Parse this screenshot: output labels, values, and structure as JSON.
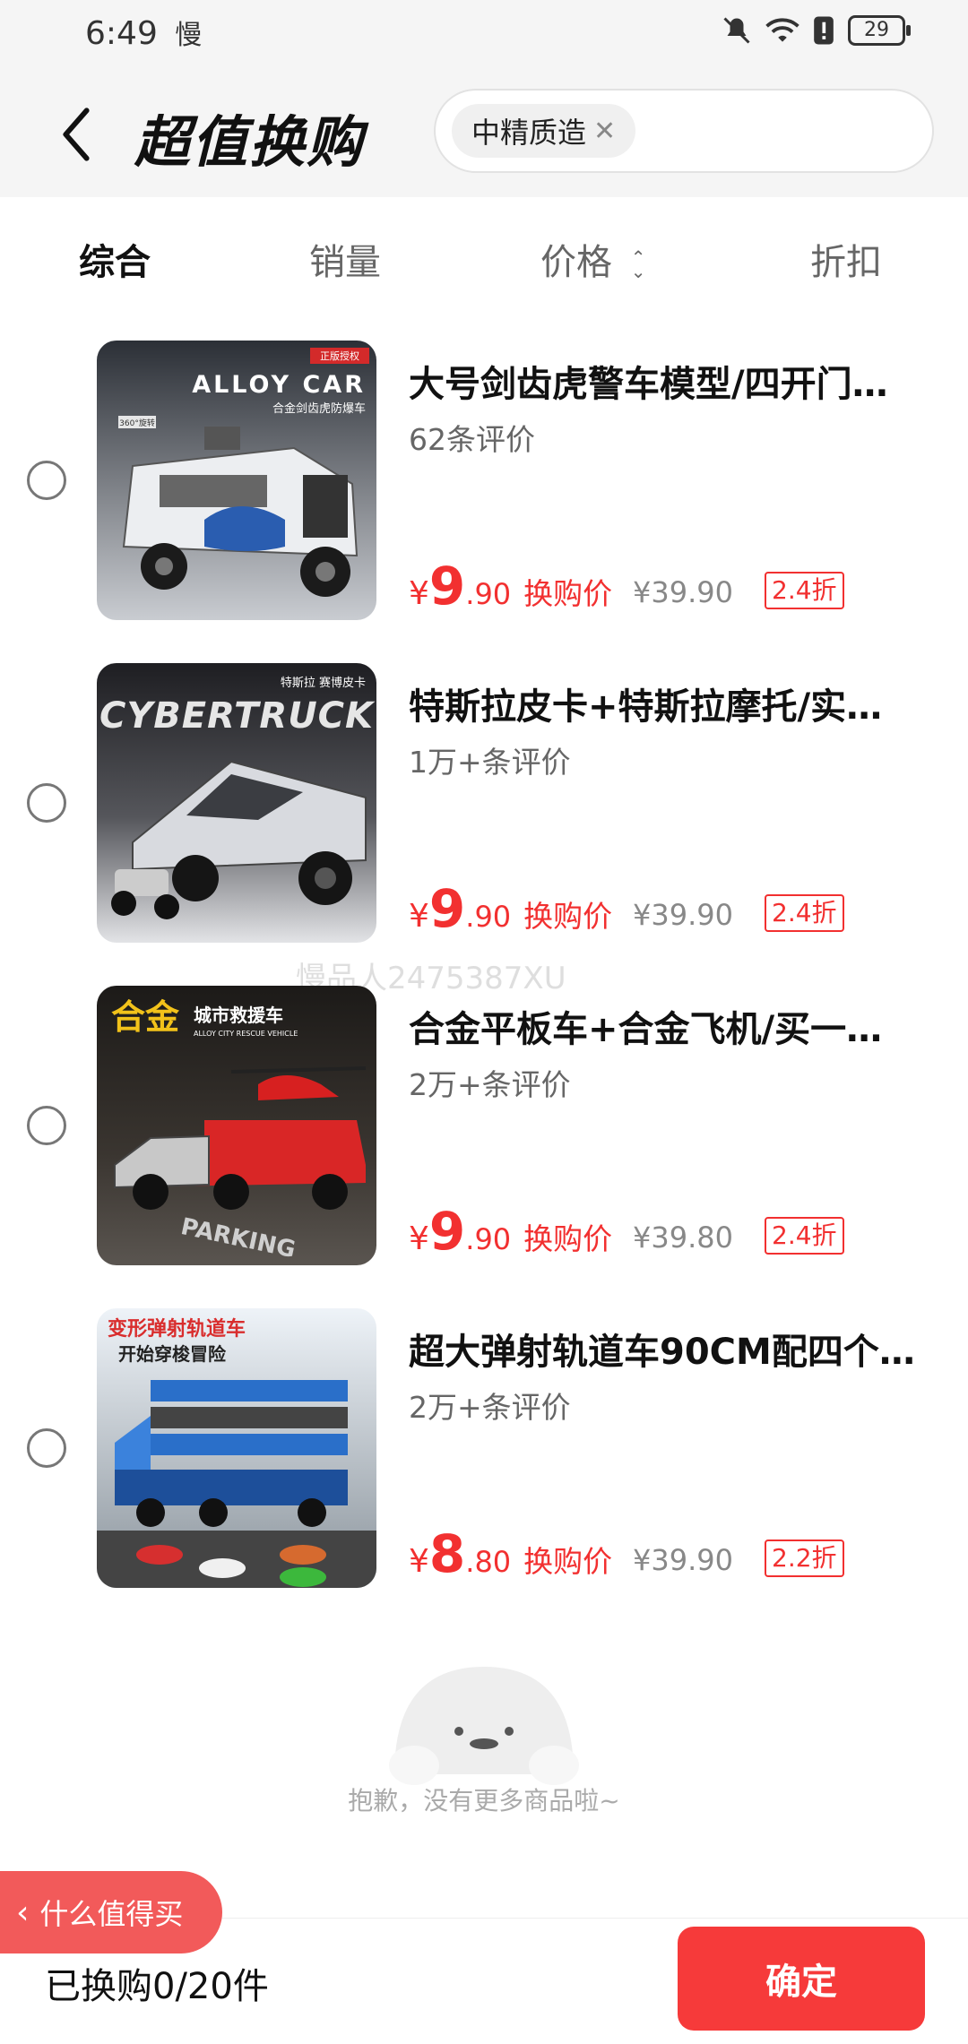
{
  "status_bar": {
    "time": "6:49",
    "app_label": "慢",
    "battery": "29"
  },
  "header": {
    "title": "超值换购",
    "search_chip": "中精质造"
  },
  "tabs": [
    {
      "label": "综合",
      "active": true
    },
    {
      "label": "销量"
    },
    {
      "label": "价格"
    },
    {
      "label": "折扣"
    }
  ],
  "products": [
    {
      "title": "大号剑齿虎警车模型/四开门…",
      "reviews": "62条评价",
      "price_symbol": "¥",
      "price_int": "9",
      "price_dec": ".90",
      "price_label": "换购价",
      "original_price": "¥39.90",
      "discount": "2.4折",
      "thumb_text": "ALLOY CAR",
      "thumb_sub": "合金剑齿虎防爆车",
      "thumb_badge": "正版授权",
      "thumb_tag": "360°旋转"
    },
    {
      "title": "特斯拉皮卡+特斯拉摩托/实…",
      "reviews": "1万+条评价",
      "price_symbol": "¥",
      "price_int": "9",
      "price_dec": ".90",
      "price_label": "换购价",
      "original_price": "¥39.90",
      "discount": "2.4折",
      "thumb_text": "CYBERTRUCK",
      "thumb_sub": "特斯拉 赛博皮卡"
    },
    {
      "title": "合金平板车+合金飞机/买一…",
      "reviews": "2万+条评价",
      "price_symbol": "¥",
      "price_int": "9",
      "price_dec": ".90",
      "price_label": "换购价",
      "original_price": "¥39.80",
      "discount": "2.4折",
      "thumb_text": "合金",
      "thumb_sub": "城市救援车",
      "thumb_sub2": "ALLOY CITY RESCUE VEHICLE",
      "thumb_tag": "PARKING"
    },
    {
      "title": "超大弹射轨道车90CM配四个…",
      "reviews": "2万+条评价",
      "price_symbol": "¥",
      "price_int": "8",
      "price_dec": ".80",
      "price_label": "换购价",
      "original_price": "¥39.90",
      "discount": "2.2折",
      "thumb_text": "变形弹射轨道车",
      "thumb_sub": "开始穿梭冒险"
    }
  ],
  "watermark": "慢品人2475387XU",
  "empty_text": "抱歉，没有更多商品啦~",
  "bottom": {
    "float_button": "什么值得买",
    "count_text": "已换购0/20件",
    "confirm": "确定"
  },
  "colors": {
    "accent": "#f23030",
    "confirm": "#f63a3a"
  }
}
